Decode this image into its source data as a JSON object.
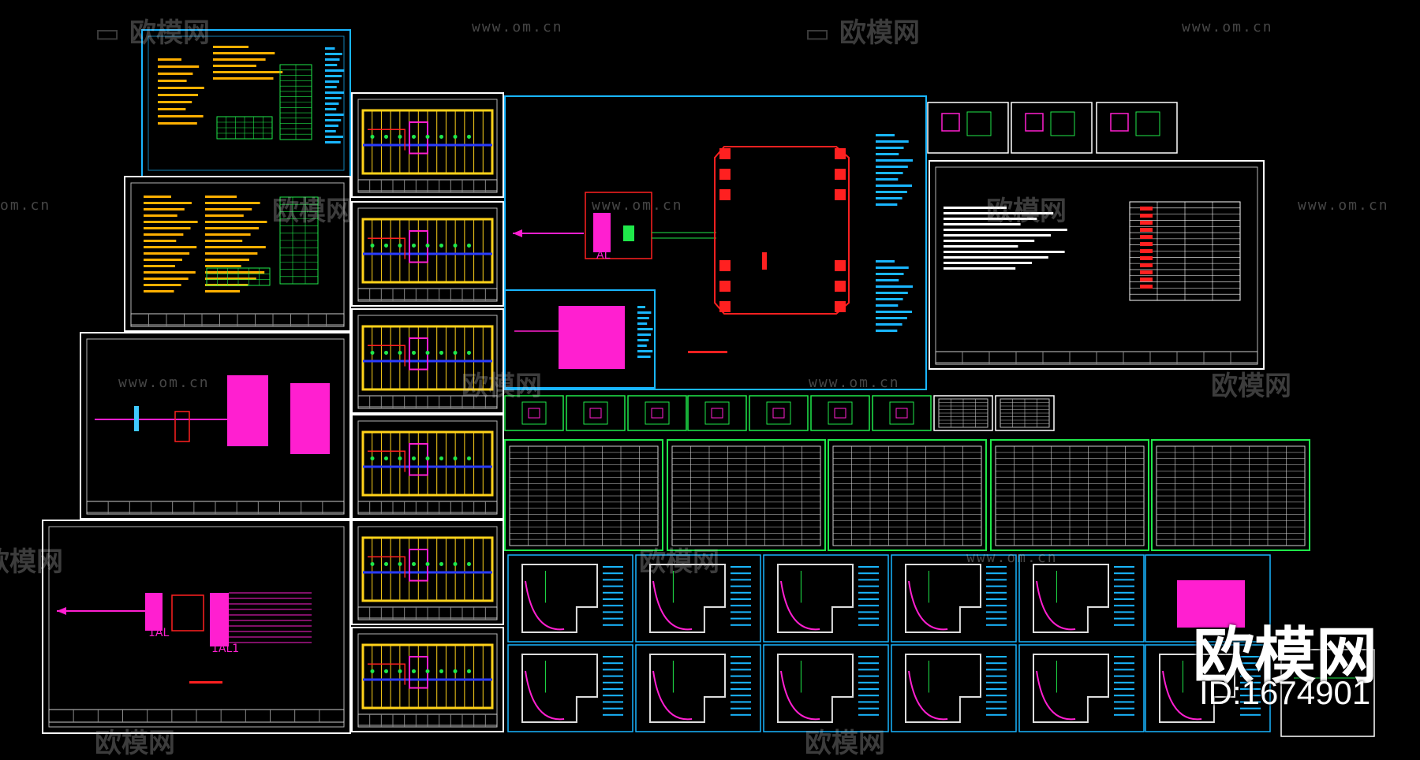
{
  "watermark": {
    "brand_cn": "欧模网",
    "url": "www.om.cn",
    "url_partial": "om.cn",
    "brand_partial": "欧模网"
  },
  "brand_overlay": {
    "logo_text": "欧模网",
    "id_text": "ID:1674901"
  },
  "diagram_labels": {
    "distribution_box_al": "AL",
    "distribution_box_1al": "1AL",
    "distribution_box_1al1": "1AL1"
  },
  "colors": {
    "background": "#000000",
    "frame_white": "#ffffff",
    "frame_cyan": "#19b6ff",
    "magenta": "#ff1fd0",
    "yellow": "#ffd21a",
    "orange": "#ffb000",
    "green": "#1fe84a",
    "red": "#ff2020",
    "blue": "#2a3cff"
  }
}
